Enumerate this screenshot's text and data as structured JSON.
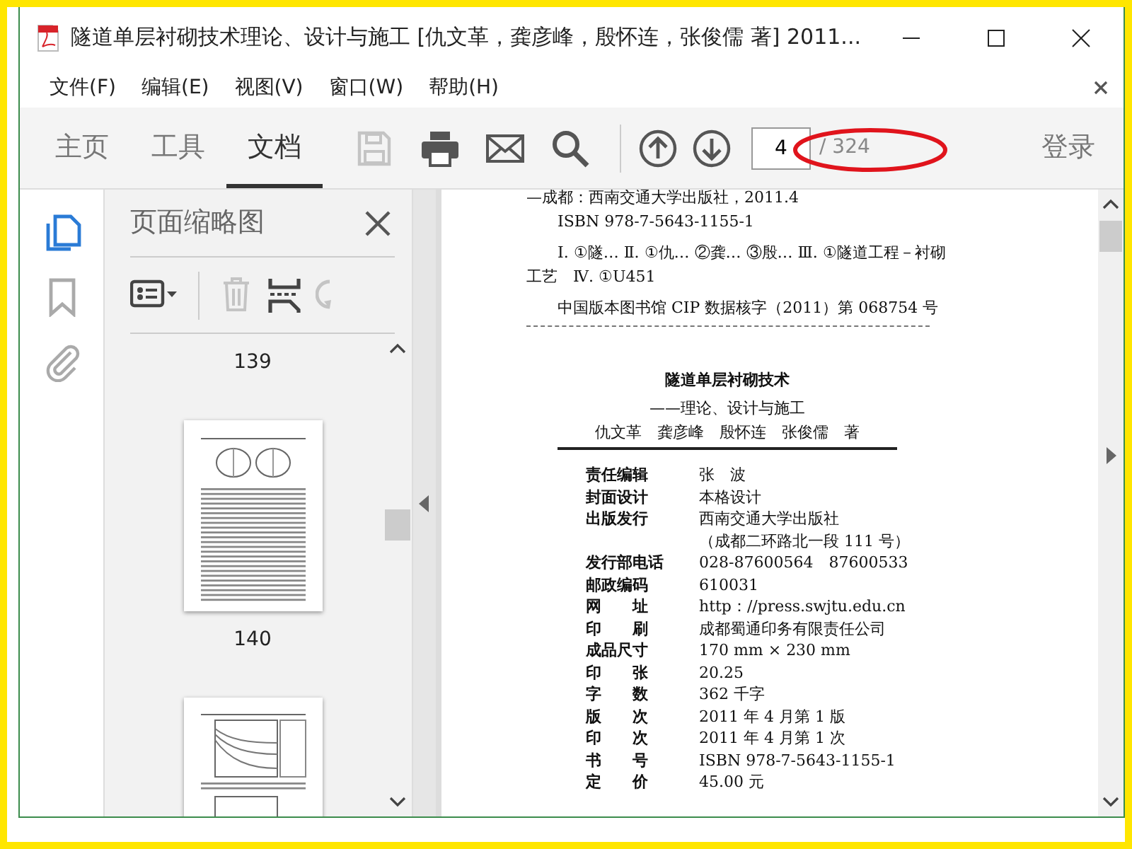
{
  "window": {
    "title": "隧道单层衬砌技术理论、设计与施工 [仇文革，龚彦峰，殷怀连，张俊儒 著] 2011..."
  },
  "menu": [
    "文件(F)",
    "编辑(E)",
    "视图(V)",
    "窗口(W)",
    "帮助(H)"
  ],
  "toolbar": {
    "tabs": [
      {
        "label": "主页",
        "selected": false
      },
      {
        "label": "工具",
        "selected": false
      },
      {
        "label": "文档",
        "selected": true
      }
    ],
    "tools": [
      {
        "kind": "save",
        "disabled": true
      },
      {
        "kind": "print",
        "disabled": false
      },
      {
        "kind": "mail",
        "disabled": false
      },
      {
        "kind": "search",
        "disabled": false
      }
    ],
    "page_input": "4",
    "page_total": "/ 324",
    "login": "登录"
  },
  "rail": [
    {
      "kind": "thumbnails",
      "selected": true
    },
    {
      "kind": "bookmarks",
      "selected": false
    },
    {
      "kind": "attachments",
      "selected": false
    }
  ],
  "side_panel": {
    "title": "页面缩略图",
    "tools": [
      {
        "kind": "options",
        "disabled": false
      },
      {
        "kind": "delete",
        "disabled": true
      },
      {
        "kind": "insert",
        "disabled": false
      },
      {
        "kind": "rotate",
        "disabled": true
      }
    ],
    "thumbnail_labels": [
      "139",
      "140"
    ]
  },
  "document": {
    "cip_lines": [
      "—成都：西南交通大学出版社，2011.4",
      "ISBN 978-7-5643-1155-1"
    ],
    "cip_subjects": "Ⅰ. ①隧… Ⅱ. ①仇… ②龚… ③殷… Ⅲ. ①隧道工程－衬砌工艺　Ⅳ. ①U451",
    "cip_number": "中国版本图书馆 CIP 数据核字（2011）第 068754 号",
    "title": "隧道单层衬砌技术",
    "subtitle": "——理论、设计与施工",
    "authors": "仇文革　龚彦峰　殷怀连　张俊儒　著",
    "credits": [
      {
        "label": "责任编辑",
        "values": [
          "张　波"
        ]
      },
      {
        "label": "封面设计",
        "values": [
          "本格设计"
        ]
      },
      {
        "label": "出版发行",
        "values": [
          "西南交通大学出版社",
          "（成都二环路北一段 111 号）"
        ]
      },
      {
        "label": "发行部电话",
        "values": [
          "028-87600564　87600533"
        ]
      },
      {
        "label": "邮政编码",
        "values": [
          "610031"
        ]
      },
      {
        "label": "网　　址",
        "values": [
          "http：//press.swjtu.edu.cn"
        ]
      },
      {
        "label": "印　　刷",
        "values": [
          "成都蜀通印务有限责任公司"
        ]
      },
      {
        "label": "成品尺寸",
        "values": [
          "170 mm × 230 mm"
        ]
      },
      {
        "label": "印　　张",
        "values": [
          "20.25"
        ]
      },
      {
        "label": "字　　数",
        "values": [
          "362 千字"
        ]
      },
      {
        "label": "版　　次",
        "values": [
          "2011 年 4 月第 1 版"
        ]
      },
      {
        "label": "印　　次",
        "values": [
          "2011 年 4 月第 1 次"
        ]
      },
      {
        "label": "书　　号",
        "values": [
          "ISBN 978-7-5643-1155-1"
        ]
      },
      {
        "label": "定　　价",
        "values": [
          "45.00 元"
        ]
      }
    ]
  }
}
